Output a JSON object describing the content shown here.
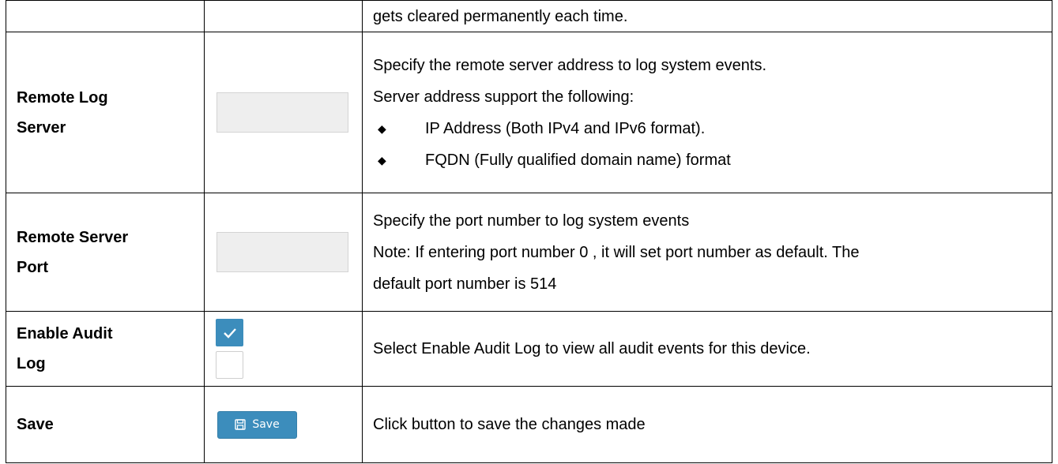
{
  "rows": {
    "continuation": {
      "desc": "gets cleared permanently each time."
    },
    "remote_log_server": {
      "name_line1": "Remote Log",
      "name_line2": "Server",
      "desc": [
        "Specify the remote server address to log system events.",
        "Server address support the following:"
      ],
      "bullets": [
        "IP Address (Both IPv4 and IPv6 format).",
        "FQDN (Fully qualified domain name) format"
      ],
      "input_value": ""
    },
    "remote_server_port": {
      "name_line1": "Remote Server",
      "name_line2": "Port",
      "desc": [
        "Specify the port number to log system events",
        "Note: If entering port number 0 , it will set port number as default. The",
        "default port number is 514"
      ],
      "input_value": ""
    },
    "enable_audit_log": {
      "name_line1": "Enable Audit",
      "name_line2": "Log",
      "desc": "Select Enable Audit Log to view all audit events for this device.",
      "checkbox_checked": true
    },
    "save": {
      "name": "Save",
      "button_label": "Save",
      "desc": "Click button to save the changes made"
    }
  },
  "colors": {
    "accent": "#3c8dbc",
    "input_bg": "#eeeeee"
  },
  "icons": {
    "bullet": "diamond-bullet-icon",
    "checkbox": "checkmark-icon",
    "save": "floppy-disk-icon"
  }
}
